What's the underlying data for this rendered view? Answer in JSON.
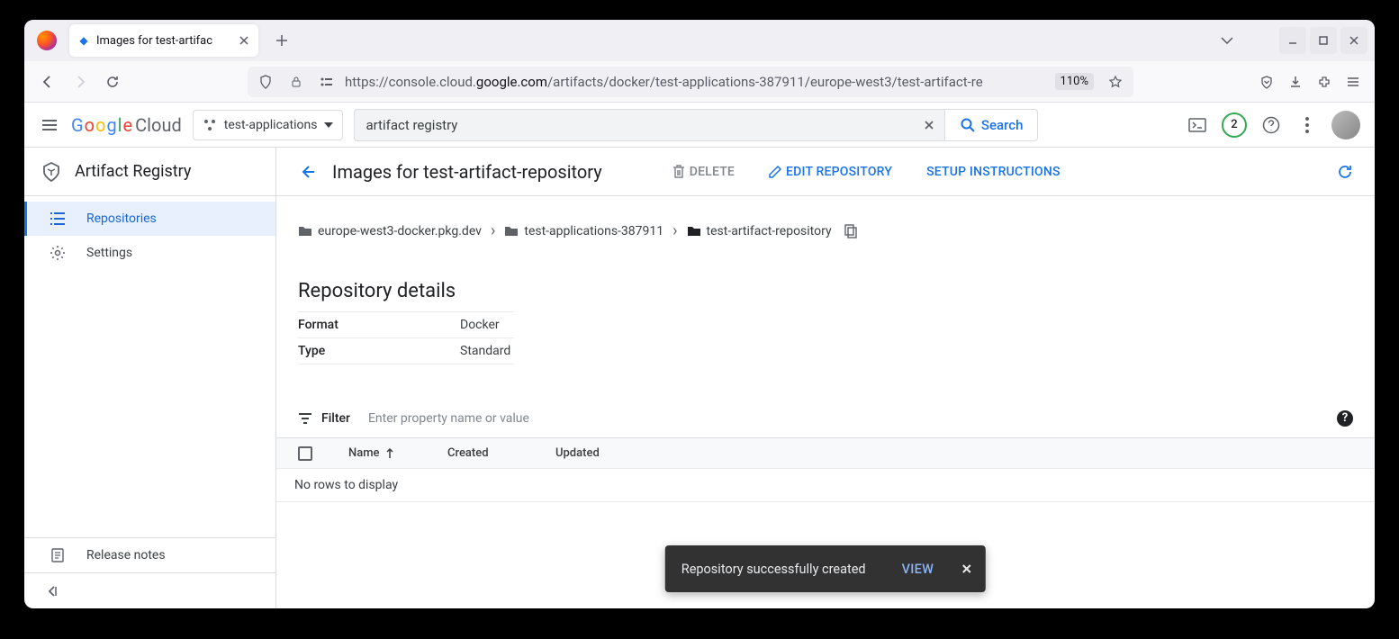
{
  "browser": {
    "tab_title": "Images for test-artifac",
    "url_display_pre": "https://console.cloud.",
    "url_display_dom": "google.com",
    "url_display_post": "/artifacts/docker/test-applications-387911/europe-west3/test-artifact-re",
    "zoom": "110%"
  },
  "gcp": {
    "logo_cloud": "Cloud",
    "project": "test-applications",
    "search_value": "artifact registry",
    "search_button": "Search",
    "notif_count": "2"
  },
  "sidebar": {
    "product": "Artifact Registry",
    "items": [
      {
        "label": "Repositories",
        "selected": true
      },
      {
        "label": "Settings",
        "selected": false
      }
    ],
    "release_notes": "Release notes"
  },
  "page": {
    "title": "Images for test-artifact-repository",
    "actions": {
      "delete": "DELETE",
      "edit": "EDIT REPOSITORY",
      "setup": "SETUP INSTRUCTIONS"
    },
    "breadcrumb": [
      "europe-west3-docker.pkg.dev",
      "test-applications-387911",
      "test-artifact-repository"
    ],
    "section_title": "Repository details",
    "details": [
      {
        "key": "Format",
        "value": "Docker"
      },
      {
        "key": "Type",
        "value": "Standard"
      }
    ],
    "filter_label": "Filter",
    "filter_placeholder": "Enter property name or value",
    "columns": {
      "name": "Name",
      "created": "Created",
      "updated": "Updated"
    },
    "empty": "No rows to display"
  },
  "toast": {
    "message": "Repository successfully created",
    "action": "VIEW"
  }
}
